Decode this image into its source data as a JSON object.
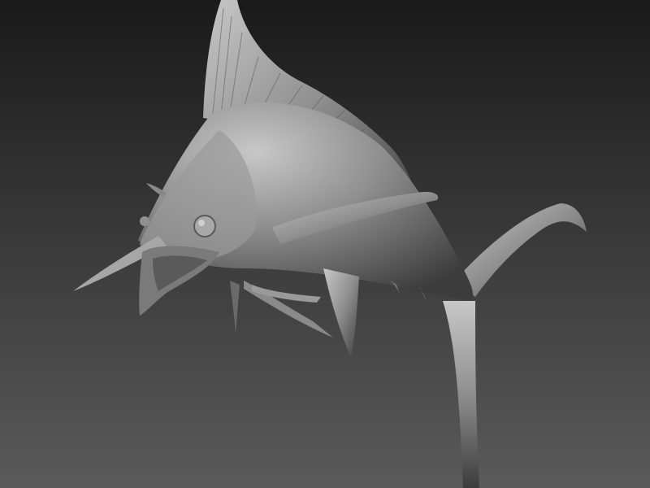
{
  "scene": {
    "subject": "sailfish-sculpt",
    "background": {
      "top_color": "#1a1a1a",
      "bottom_color": "#5a5a5a"
    },
    "material": {
      "base_color": "#8e8e8e",
      "highlight_color": "#c8c8c8",
      "shadow_color": "#3c3c3c"
    }
  }
}
